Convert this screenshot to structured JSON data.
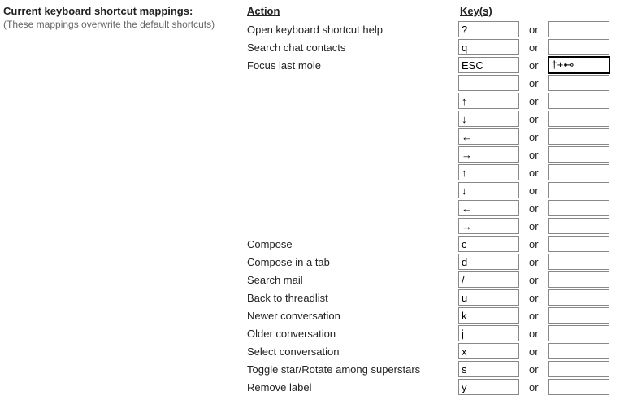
{
  "left": {
    "title": "Current keyboard shortcut mappings:",
    "subtitle": "(These mappings overwrite the default shortcuts)"
  },
  "headers": {
    "action": "Action",
    "keys": "Key(s)"
  },
  "or_label": "or",
  "rows": [
    {
      "action": "Open keyboard shortcut help",
      "key1": "?",
      "key2": ""
    },
    {
      "action": "Search chat contacts",
      "key1": "q",
      "key2": ""
    },
    {
      "action": "Focus last mole",
      "key1": "ESC",
      "key2": "†+⊷",
      "focus2": true
    },
    {
      "action": "",
      "key1": "",
      "key2": ""
    },
    {
      "action": "",
      "key1": "↑",
      "key2": ""
    },
    {
      "action": "",
      "key1": "↓",
      "key2": ""
    },
    {
      "action": "",
      "key1": "←",
      "key2": ""
    },
    {
      "action": "",
      "key1": "→",
      "key2": ""
    },
    {
      "action": "",
      "key1": "↑",
      "key2": ""
    },
    {
      "action": "",
      "key1": "↓",
      "key2": ""
    },
    {
      "action": "",
      "key1": "←",
      "key2": ""
    },
    {
      "action": "",
      "key1": "→",
      "key2": ""
    },
    {
      "action": "Compose",
      "key1": "c",
      "key2": ""
    },
    {
      "action": "Compose in a tab",
      "key1": "d",
      "key2": ""
    },
    {
      "action": "Search mail",
      "key1": "/",
      "key2": ""
    },
    {
      "action": "Back to threadlist",
      "key1": "u",
      "key2": ""
    },
    {
      "action": "Newer conversation",
      "key1": "k",
      "key2": ""
    },
    {
      "action": "Older conversation",
      "key1": "j",
      "key2": ""
    },
    {
      "action": "Select conversation",
      "key1": "x",
      "key2": ""
    },
    {
      "action": "Toggle star/Rotate among superstars",
      "key1": "s",
      "key2": ""
    },
    {
      "action": "Remove label",
      "key1": "y",
      "key2": ""
    }
  ]
}
